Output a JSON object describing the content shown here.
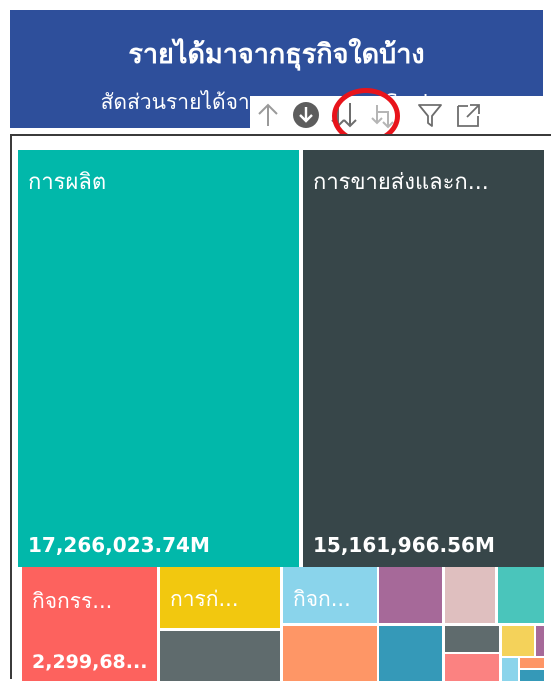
{
  "header": {
    "title": "รายได้มาจากธุรกิจใดบ้าง",
    "subtitle": "สัดส่วนรายได้จาก ธุรกรรมทาง Sector"
  },
  "toolbar": {
    "buttons": [
      {
        "name": "drill-up-icon"
      },
      {
        "name": "drill-down-mode-icon"
      },
      {
        "name": "go-to-next-level-icon"
      },
      {
        "name": "expand-next-level-icon"
      },
      {
        "name": "filter-icon"
      },
      {
        "name": "focus-mode-icon"
      }
    ]
  },
  "treemap": {
    "tiles": [
      {
        "label": "การผลิต",
        "value": "17,266,023.74M",
        "color": "#01b8aa"
      },
      {
        "label": "การขายส่งและก...",
        "value": "15,161,966.56M",
        "color": "#374649"
      },
      {
        "label": "กิจกรร...",
        "value": "2,299,68...",
        "color": "#fd625e"
      },
      {
        "label": "การก่...",
        "color": "#f2c80f"
      },
      {
        "label": "กิจก...",
        "color": "#8ad4eb"
      }
    ],
    "other_colors": [
      "#5f6b6d",
      "#fe9666",
      "#a66999",
      "#3599b8",
      "#dfbfbf",
      "#4ac5bb",
      "#fb8281",
      "#f4d25a"
    ]
  }
}
